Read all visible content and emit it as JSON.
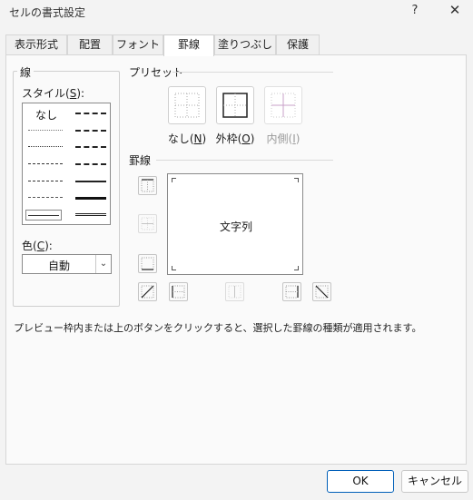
{
  "window": {
    "title": "セルの書式設定",
    "help": "?",
    "close": "✕"
  },
  "tabs": [
    {
      "label": "表示形式",
      "active": false
    },
    {
      "label": "配置",
      "active": false
    },
    {
      "label": "フォント",
      "active": false
    },
    {
      "label": "罫線",
      "active": true
    },
    {
      "label": "塗りつぶし",
      "active": false
    },
    {
      "label": "保護",
      "active": false
    }
  ],
  "line_group": {
    "title": "線",
    "style_label_pre": "スタイル(",
    "style_label_key": "S",
    "style_label_post": "):",
    "none_label": "なし",
    "color_label_pre": "色(",
    "color_label_key": "C",
    "color_label_post": "):",
    "color_value": "自動",
    "selected_style": "double"
  },
  "preset": {
    "title": "プリセット",
    "none_pre": "なし(",
    "none_key": "N",
    "none_post": ")",
    "outline_pre": "外枠(",
    "outline_key": "O",
    "outline_post": ")",
    "inside_pre": "内側(",
    "inside_key": "I",
    "inside_post": ")"
  },
  "border": {
    "title": "罫線",
    "preview_text": "文字列"
  },
  "info_text": "プレビュー枠内または上のボタンをクリックすると、選択した罫線の種類が適用されます。",
  "buttons": {
    "ok": "OK",
    "cancel": "キャンセル"
  },
  "colors": {
    "accent": "#005fb8",
    "disabled": "#9a9a9a"
  }
}
